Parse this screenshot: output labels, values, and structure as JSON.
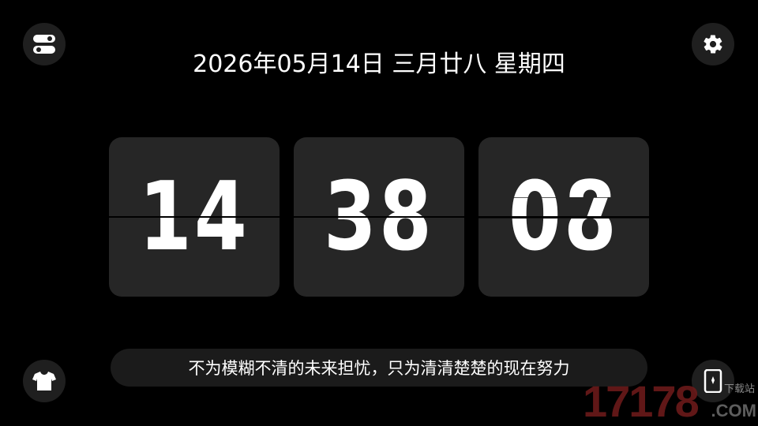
{
  "header": {
    "date": "2026年05月14日 三月廿八 星期四"
  },
  "clock": {
    "hours": "14",
    "minutes": "38",
    "seconds": "08",
    "seconds_next": "07"
  },
  "quote": "不为模糊不清的未来担忧，只为清清楚楚的现在努力",
  "buttons": {
    "toggle_icon": "toggle-switch-icon",
    "settings_icon": "gear-icon",
    "theme_icon": "tshirt-icon",
    "card_icon": "card-icon"
  },
  "watermark": {
    "number": "17178",
    "domain": ".COM",
    "tag": "下载站"
  }
}
